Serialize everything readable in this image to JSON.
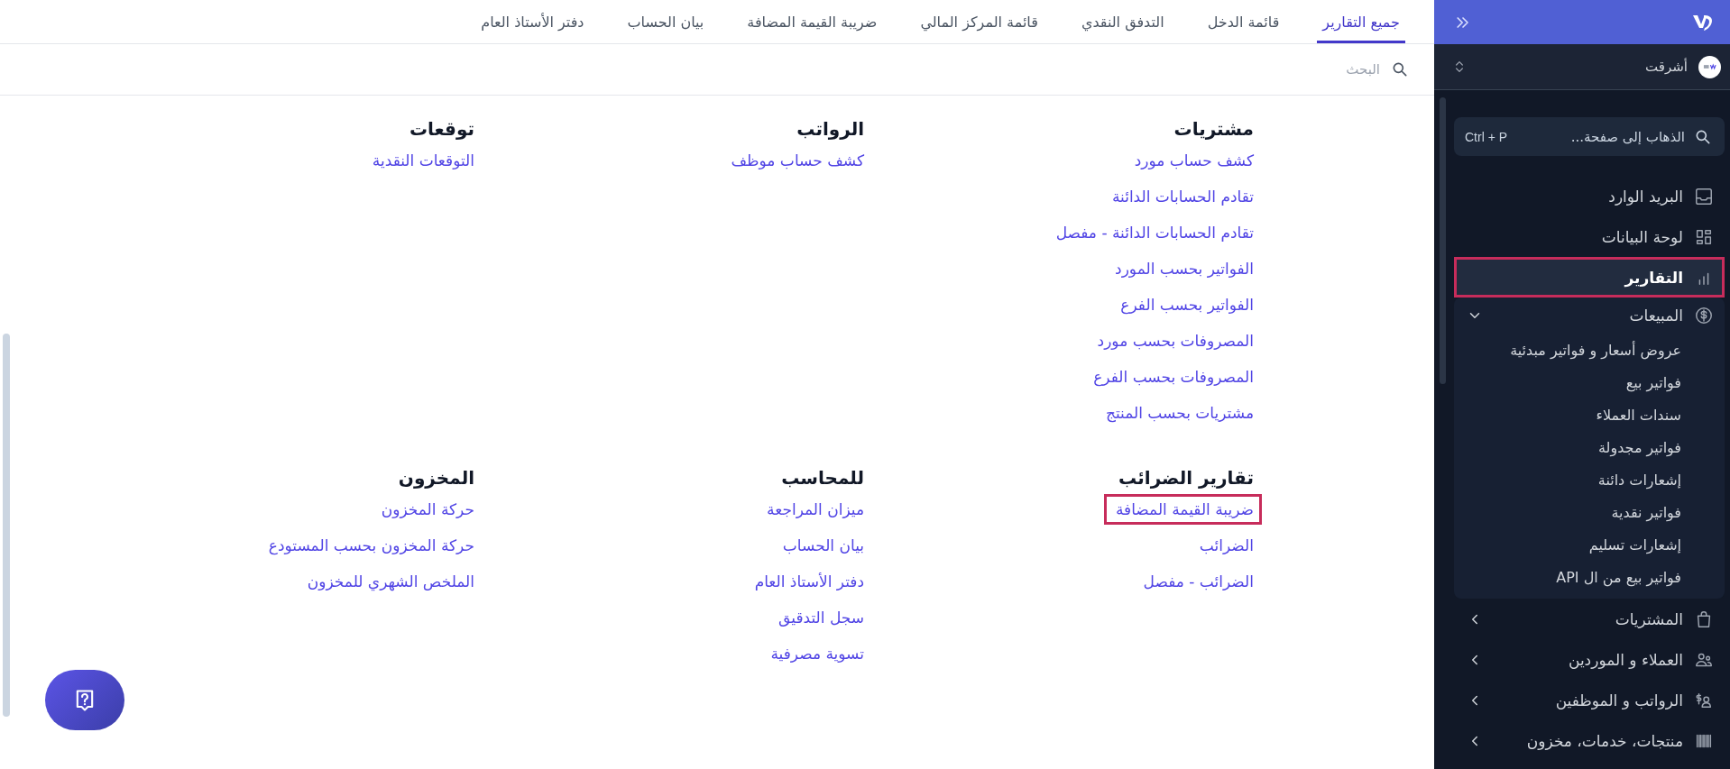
{
  "sidebar": {
    "company": {
      "name": "أشرقت"
    },
    "goto": {
      "placeholder": "الذهاب إلى صفحة...",
      "shortcut": "Ctrl + P"
    },
    "nav": [
      {
        "label": "البريد الوارد",
        "kind": "link",
        "selected": false,
        "highlighted": false
      },
      {
        "label": "لوحة البيانات",
        "kind": "link",
        "selected": false,
        "highlighted": false
      },
      {
        "label": "التقارير",
        "kind": "link",
        "selected": true,
        "highlighted": true
      },
      {
        "label": "المبيعات",
        "kind": "group",
        "selected": false,
        "highlighted": false,
        "expanded": true,
        "children": [
          {
            "label": "عروض أسعار و فواتير مبدئية"
          },
          {
            "label": "فواتير بيع"
          },
          {
            "label": "سندات العملاء"
          },
          {
            "label": "فواتير مجدولة"
          },
          {
            "label": "إشعارات دائنة"
          },
          {
            "label": "فواتير نقدية"
          },
          {
            "label": "إشعارات تسليم"
          },
          {
            "label": "فواتير بيع من ال API"
          }
        ]
      },
      {
        "label": "المشتريات",
        "kind": "group",
        "selected": false,
        "highlighted": false,
        "expanded": false
      },
      {
        "label": "العملاء و الموردين",
        "kind": "group",
        "selected": false,
        "highlighted": false,
        "expanded": false
      },
      {
        "label": "الرواتب و الموظفين",
        "kind": "group",
        "selected": false,
        "highlighted": false,
        "expanded": false
      },
      {
        "label": "منتجات، خدمات، مخزون",
        "kind": "group",
        "selected": false,
        "highlighted": false,
        "expanded": false
      }
    ]
  },
  "tabs": [
    {
      "label": "جميع التقارير",
      "selected": true
    },
    {
      "label": "قائمة الدخل",
      "selected": false
    },
    {
      "label": "التدفق النقدي",
      "selected": false
    },
    {
      "label": "قائمة المركز المالي",
      "selected": false
    },
    {
      "label": "ضريبة القيمة المضافة",
      "selected": false
    },
    {
      "label": "بيان الحساب",
      "selected": false
    },
    {
      "label": "دفتر الأستاذ العام",
      "selected": false
    }
  ],
  "search": {
    "placeholder": "البحث"
  },
  "sections": [
    {
      "title": "مشتريات",
      "links": [
        {
          "label": "كشف حساب مورد",
          "highlighted": false
        },
        {
          "label": "تقادم الحسابات الدائنة",
          "highlighted": false
        },
        {
          "label": "تقادم الحسابات الدائنة - مفصل",
          "highlighted": false
        },
        {
          "label": "الفواتير بحسب المورد",
          "highlighted": false
        },
        {
          "label": "الفواتير بحسب الفرع",
          "highlighted": false
        },
        {
          "label": "المصروفات بحسب مورد",
          "highlighted": false
        },
        {
          "label": "المصروفات بحسب الفرع",
          "highlighted": false
        },
        {
          "label": "مشتريات بحسب المنتج",
          "highlighted": false
        }
      ]
    },
    {
      "title": "الرواتب",
      "links": [
        {
          "label": "كشف حساب موظف",
          "highlighted": false
        }
      ]
    },
    {
      "title": "توقعات",
      "links": [
        {
          "label": "التوقعات النقدية",
          "highlighted": false
        }
      ]
    },
    {
      "title": "تقارير الضرائب",
      "links": [
        {
          "label": "ضريبة القيمة المضافة",
          "highlighted": true
        },
        {
          "label": "الضرائب",
          "highlighted": false
        },
        {
          "label": "الضرائب - مفصل",
          "highlighted": false
        }
      ]
    },
    {
      "title": "للمحاسب",
      "links": [
        {
          "label": "ميزان المراجعة",
          "highlighted": false
        },
        {
          "label": "بيان الحساب",
          "highlighted": false
        },
        {
          "label": "دفتر الأستاذ العام",
          "highlighted": false
        },
        {
          "label": "سجل التدقيق",
          "highlighted": false
        },
        {
          "label": "تسوية مصرفية",
          "highlighted": false
        }
      ]
    },
    {
      "title": "المخزون",
      "links": [
        {
          "label": "حركة المخزون",
          "highlighted": false
        },
        {
          "label": "حركة المخزون بحسب المستودع",
          "highlighted": false
        },
        {
          "label": "الملخص الشهري للمخزون",
          "highlighted": false
        }
      ]
    }
  ]
}
